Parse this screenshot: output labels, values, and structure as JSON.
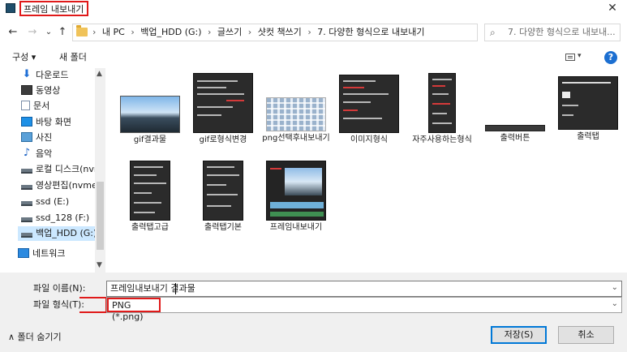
{
  "window": {
    "title": "프레임 내보내기",
    "close_glyph": "✕"
  },
  "nav": {
    "back_glyph": "←",
    "forward_glyph": "→",
    "recent_glyph": "⌄",
    "up_glyph": "↑",
    "breadcrumbs": [
      "내 PC",
      "백업_HDD (G:)",
      "글쓰기",
      "샷컷 책쓰기",
      "7. 다양한 형식으로 내보내기"
    ],
    "separator": "›",
    "dropdown_glyph": "⌄",
    "refresh_glyph": "↻",
    "search_placeholder": "7. 다양한 형식으로 내보내...",
    "search_glyph": "⌕"
  },
  "toolbar": {
    "organize": "구성 ▾",
    "new_folder": "새 폴더",
    "view_drop": "▾",
    "help": "?"
  },
  "sidebar": {
    "items": [
      {
        "label": "다운로드",
        "icon": "download-icon",
        "glyph": "⬇"
      },
      {
        "label": "동영상",
        "icon": "video-icon",
        "glyph": ""
      },
      {
        "label": "문서",
        "icon": "document-icon",
        "glyph": ""
      },
      {
        "label": "바탕 화면",
        "icon": "desktop-icon",
        "glyph": ""
      },
      {
        "label": "사진",
        "icon": "pictures-icon",
        "glyph": ""
      },
      {
        "label": "음악",
        "icon": "music-icon",
        "glyph": "♪"
      },
      {
        "label": "로컬 디스크(nvme",
        "icon": "drive-icon",
        "glyph": ""
      },
      {
        "label": "영상편집(nvme)",
        "icon": "drive-icon",
        "glyph": ""
      },
      {
        "label": "ssd (E:)",
        "icon": "drive-icon",
        "glyph": ""
      },
      {
        "label": "ssd_128 (F:)",
        "icon": "drive-icon",
        "glyph": ""
      },
      {
        "label": "백업_HDD (G:)",
        "icon": "drive-icon",
        "glyph": ""
      },
      {
        "label": "네트워크",
        "icon": "network-icon",
        "glyph": ""
      }
    ],
    "scroll_up": "▲",
    "scroll_down": "▼"
  },
  "files": [
    {
      "label": "gif결과물"
    },
    {
      "label": "gif로형식변경"
    },
    {
      "label": "png선택후내보내기"
    },
    {
      "label": "이미지형식"
    },
    {
      "label": "자주사용하는형식"
    },
    {
      "label": "출력버튼"
    },
    {
      "label": "출력탭"
    },
    {
      "label": "출력탭고급"
    },
    {
      "label": "출력탭기본"
    },
    {
      "label": "프레임내보내기"
    }
  ],
  "bottom": {
    "filename_label": "파일 이름(N):",
    "filename_value": "프레임내보내기 결과물",
    "filetype_label": "파일 형식(T):",
    "filetype_value": "PNG (*.png)",
    "drop_glyph": "⌄",
    "hide_folders": "∧ 폴더 숨기기",
    "save": "저장(S)",
    "cancel": "취소"
  },
  "colors": {
    "highlight_red": "#e01a1a",
    "selection": "#cce8ff",
    "accent": "#0078d7"
  }
}
